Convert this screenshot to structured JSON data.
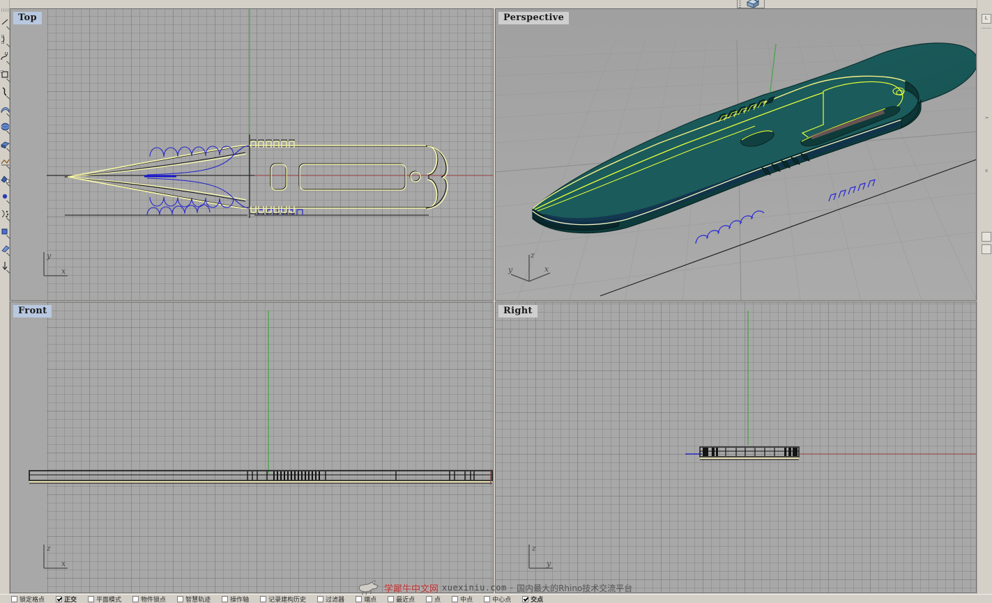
{
  "app": {
    "title": "Rhinoceros",
    "background_color": "#d4d0c8",
    "viewport_bg_color": "#a8a8a8"
  },
  "top_toolbar": {
    "buttons": [
      {
        "name": "box-tool",
        "icon": "box-icon",
        "label": ""
      }
    ]
  },
  "left_toolbar": {
    "icons": [
      "line-icon",
      "polyline-icon",
      "arc-icon",
      "curve-icon",
      "rectangle-icon",
      "freeform-curve-icon",
      "surface-icon",
      "sphere-icon",
      "solid-extrude-icon",
      "mesh-icon",
      "transform-icon",
      "box-solid-icon",
      "point-icon",
      "analyze-icon",
      "dimension-icon",
      "render-icon",
      "light-icon"
    ]
  },
  "right_panel": {
    "icons": [
      "layer-icon",
      "properties-icon",
      "notes-icon"
    ],
    "buttons": [
      "help-button",
      "options-button"
    ]
  },
  "viewports": [
    {
      "id": "top",
      "label": "Top",
      "label_style": "blue",
      "active": true,
      "display_mode": "wireframe",
      "axes": {
        "up": "y",
        "right": "x"
      },
      "construction_plane_grid": true
    },
    {
      "id": "perspective",
      "label": "Perspective",
      "label_style": "gray",
      "active": false,
      "display_mode": "shaded",
      "axes": {
        "up": "z",
        "right": "x",
        "depth": "y"
      },
      "object_color": "#1d5e5e",
      "selection_color": "#ffff4d",
      "construction_plane_grid": true
    },
    {
      "id": "front",
      "label": "Front",
      "label_style": "blue",
      "active": false,
      "display_mode": "wireframe",
      "axes": {
        "up": "z",
        "right": "x"
      },
      "construction_plane_grid": true
    },
    {
      "id": "right",
      "label": "Right",
      "label_style": "gray",
      "active": false,
      "display_mode": "wireframe",
      "axes": {
        "up": "z",
        "right": "y"
      },
      "construction_plane_grid": true
    }
  ],
  "model": {
    "description": "Tactical knife / blade with serrated spine and skeletonized handle",
    "curve_colors": {
      "selected": "#fdfdb0",
      "construction": "#2020d0",
      "default": "#101010",
      "x_axis": "#a05050",
      "y_axis": "#50a050",
      "z_axis": "#50a050"
    }
  },
  "watermark": {
    "site_cn": "学犀牛中文网",
    "url": "xuexiniu.com",
    "separator": "-",
    "tagline": "国内最大的Rhino技术交流平台",
    "logo": "rhino-logo-icon"
  },
  "status_bar": {
    "items": [
      {
        "label": "锁定格点",
        "checked": false
      },
      {
        "label": "正交",
        "checked": true
      },
      {
        "label": "平面模式",
        "checked": false
      },
      {
        "label": "物件锁点",
        "checked": false
      },
      {
        "label": "智慧轨迹",
        "checked": false
      },
      {
        "label": "操作轴",
        "checked": false
      },
      {
        "label": "记录建构历史",
        "checked": false
      },
      {
        "label": "过滤器",
        "checked": false
      },
      {
        "label": "端点",
        "checked": false
      },
      {
        "label": "最近点",
        "checked": false
      },
      {
        "label": "点",
        "checked": false
      },
      {
        "label": "中点",
        "checked": false
      },
      {
        "label": "中心点",
        "checked": false
      },
      {
        "label": "交点",
        "checked": true
      }
    ]
  }
}
